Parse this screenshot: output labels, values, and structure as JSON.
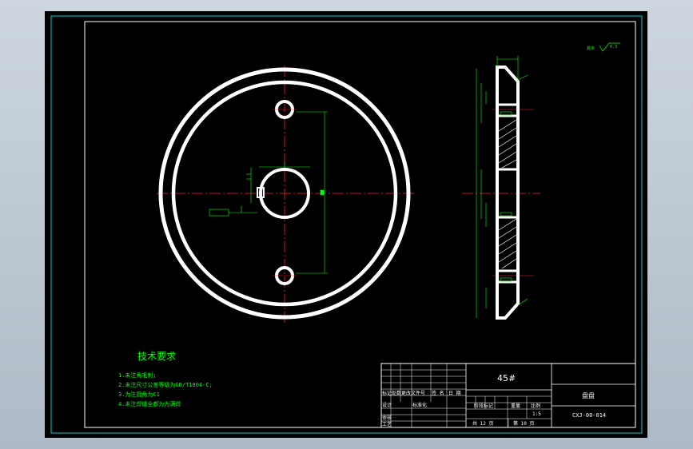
{
  "drawing": {
    "title": "技术要求",
    "requirements": [
      "1.未注角毛刺;",
      "2.未注尺寸公差等级为GB/T1804-C;",
      "3.为注圆角为C1",
      "4.未注焊缝全都为为满焊"
    ],
    "surface_note": "其余",
    "surface_value": "6.3"
  },
  "title_block": {
    "material": "45#",
    "part_name": "盘盘",
    "drawing_number": "CXJ-00-014",
    "scale": "1:5",
    "sheet_total": "共 12 页",
    "sheet_current": "第 10 页",
    "header_cells": [
      "标记",
      "处数",
      "更改文件号",
      "签 名",
      "日 期"
    ],
    "stage_label": "阶段标记",
    "weight_label": "重量",
    "ratio_label": "比例",
    "design_label": "设计",
    "check_label": "审核",
    "process_label": "工艺",
    "std_label": "标准化"
  },
  "colors": {
    "background": "#000000",
    "outer_frame": "#00d0d0",
    "border": "#ffffff",
    "geometry": "#ffffff",
    "centerline": "#ff2020",
    "dimension": "#00ff00",
    "hatch": "#ffffff"
  }
}
